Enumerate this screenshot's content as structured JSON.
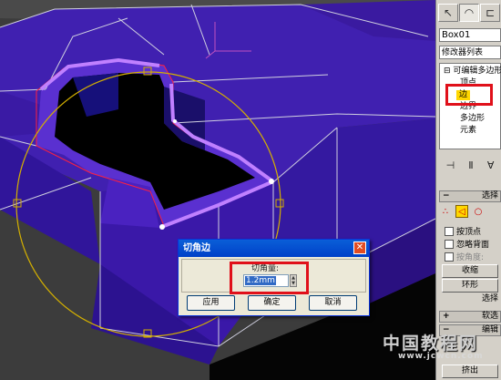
{
  "viewport": {
    "background": "#3a3a3a",
    "object_color": "#3c1ca8",
    "selected_edge_color": "#c080ff",
    "gizmo_color": "#d4b000"
  },
  "command_panel": {
    "tabs": [
      {
        "name": "create-tab",
        "icon": "pointer-icon"
      },
      {
        "name": "modify-tab",
        "icon": "arc-icon"
      },
      {
        "name": "hierarchy-tab",
        "icon": "hierarchy-icon"
      }
    ],
    "object_name": "Box01",
    "modifier_list_label": "修改器列表",
    "stack": {
      "root": "可编辑多边形",
      "items": [
        "顶点",
        "边",
        "边界",
        "多边形",
        "元素"
      ],
      "selected": "边"
    },
    "rollout_selection_label": "选择",
    "sub_object_icons": [
      "vertex-icon",
      "edge-icon",
      "border-icon"
    ],
    "checkboxes": [
      {
        "label": "按顶点",
        "enabled": true
      },
      {
        "label": "忽略背面",
        "enabled": true
      },
      {
        "label": "按角度:",
        "enabled": false
      }
    ],
    "buttons": [
      "收缩",
      "环形",
      "选择"
    ],
    "rollout_soft_label": "软选",
    "rollout_edit_label": "编辑",
    "more_label": "挤出"
  },
  "dialog": {
    "title": "切角边",
    "field_label": "切角量:",
    "field_value": "1.2mm",
    "apply": "应用",
    "ok": "确定",
    "cancel": "取消"
  },
  "watermark": {
    "text": "中国教程网",
    "url": "www.jcwcn.com"
  },
  "highlight_color": "#e0101a"
}
